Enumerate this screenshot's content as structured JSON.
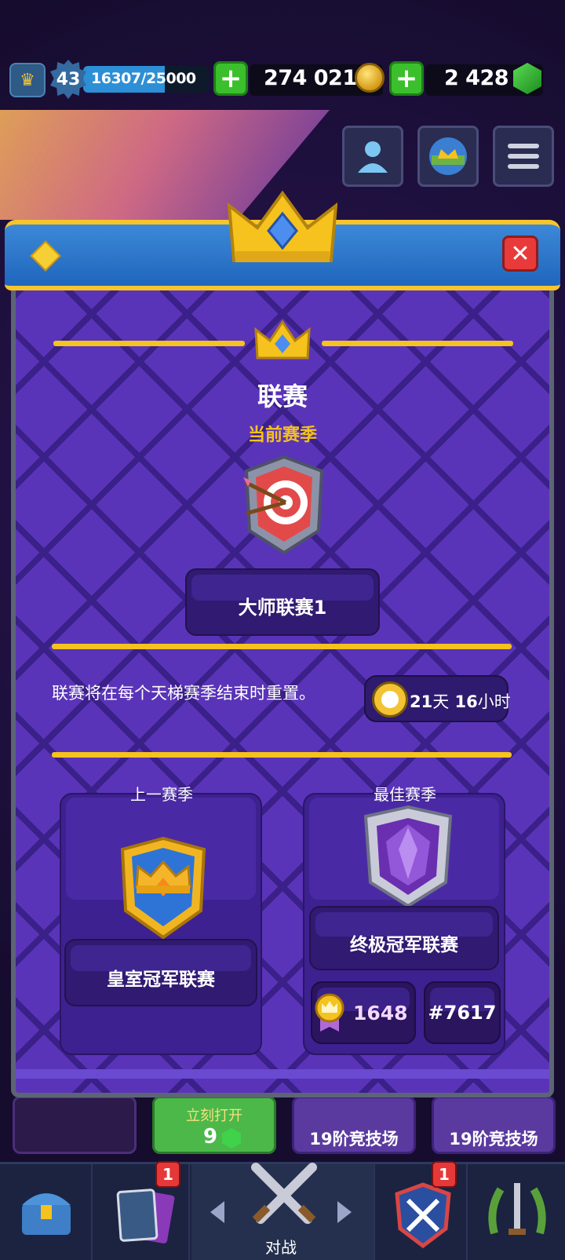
{
  "top_bar": {
    "king_level": "43",
    "xp_text": "16307/25000",
    "xp_fraction": 0.652,
    "gold": "274 021",
    "gems": "2 428",
    "icons": [
      "crown-icon",
      "plus-icon",
      "coin-icon",
      "plus-icon",
      "gem-icon"
    ]
  },
  "header_menu": {
    "icons": [
      "friends-icon",
      "clan-icon",
      "hamburger-menu-icon"
    ]
  },
  "modal": {
    "title": "联赛",
    "current_season_label": "当前赛季",
    "current_league": "大师联赛1",
    "reset_text": "联赛将在每个天梯赛季结束时重置。",
    "timer": {
      "days_value": "21",
      "days_unit": "天",
      "hours_value": "16",
      "hours_unit": "小时"
    },
    "previous_season": {
      "label": "上一赛季",
      "league": "皇室冠军联赛"
    },
    "best_season": {
      "label": "最佳赛季",
      "league": "终极冠军联赛",
      "rating": "1648",
      "rank": "#7617"
    },
    "close_icon": "close-icon"
  },
  "chests": [
    {
      "label": "立刻打开",
      "value": "9"
    },
    {
      "label": "19阶竞技场"
    },
    {
      "label": "19阶竞技场"
    }
  ],
  "nav": {
    "cards_badge": "1",
    "clan_badge": "1",
    "battle_label": "对战"
  },
  "colors": {
    "gold_line": "#f5c21e",
    "header_blue": "#1f66bd",
    "modal_purple": "#5a34b8",
    "close_red": "#e83a3a",
    "plus_green": "#3bbf2c"
  }
}
